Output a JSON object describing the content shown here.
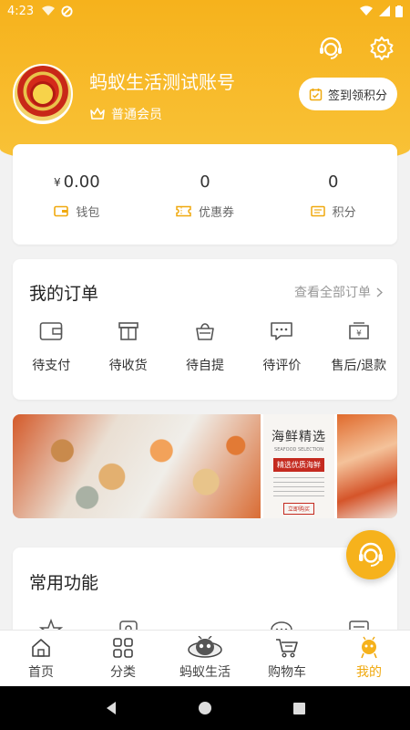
{
  "status_bar": {
    "time": "4:23"
  },
  "colors": {
    "accent": "#f6b21c",
    "active": "#f0a90f"
  },
  "profile": {
    "username": "蚂蚁生活测试账号",
    "member_level": "普通会员",
    "signin_label": "签到领积分",
    "avatar_icon": "police-emblem-avatar"
  },
  "stats": [
    {
      "currency": "¥",
      "value": "0.00",
      "label": "钱包",
      "icon": "wallet-icon"
    },
    {
      "currency": "",
      "value": "0",
      "label": "优惠券",
      "icon": "coupon-icon"
    },
    {
      "currency": "",
      "value": "0",
      "label": "积分",
      "icon": "points-icon"
    }
  ],
  "orders": {
    "title": "我的订单",
    "view_all": "查看全部订单",
    "items": [
      {
        "label": "待支付",
        "icon": "wallet-icon"
      },
      {
        "label": "待收货",
        "icon": "box-icon"
      },
      {
        "label": "待自提",
        "icon": "basket-icon"
      },
      {
        "label": "待评价",
        "icon": "comment-icon"
      },
      {
        "label": "售后/退款",
        "icon": "refund-icon"
      }
    ]
  },
  "banner": {
    "title": "海鲜精选",
    "subtitle": "SEAFOOD SELECTION",
    "ribbon": "精选优质海鲜",
    "button": "立即购买"
  },
  "features": {
    "title": "常用功能"
  },
  "nav": [
    {
      "label": "首页",
      "icon": "home-icon"
    },
    {
      "label": "分类",
      "icon": "category-icon"
    },
    {
      "label": "蚂蚁生活",
      "icon": "ant-mascot-icon"
    },
    {
      "label": "购物车",
      "icon": "cart-icon"
    },
    {
      "label": "我的",
      "icon": "profile-icon"
    }
  ]
}
